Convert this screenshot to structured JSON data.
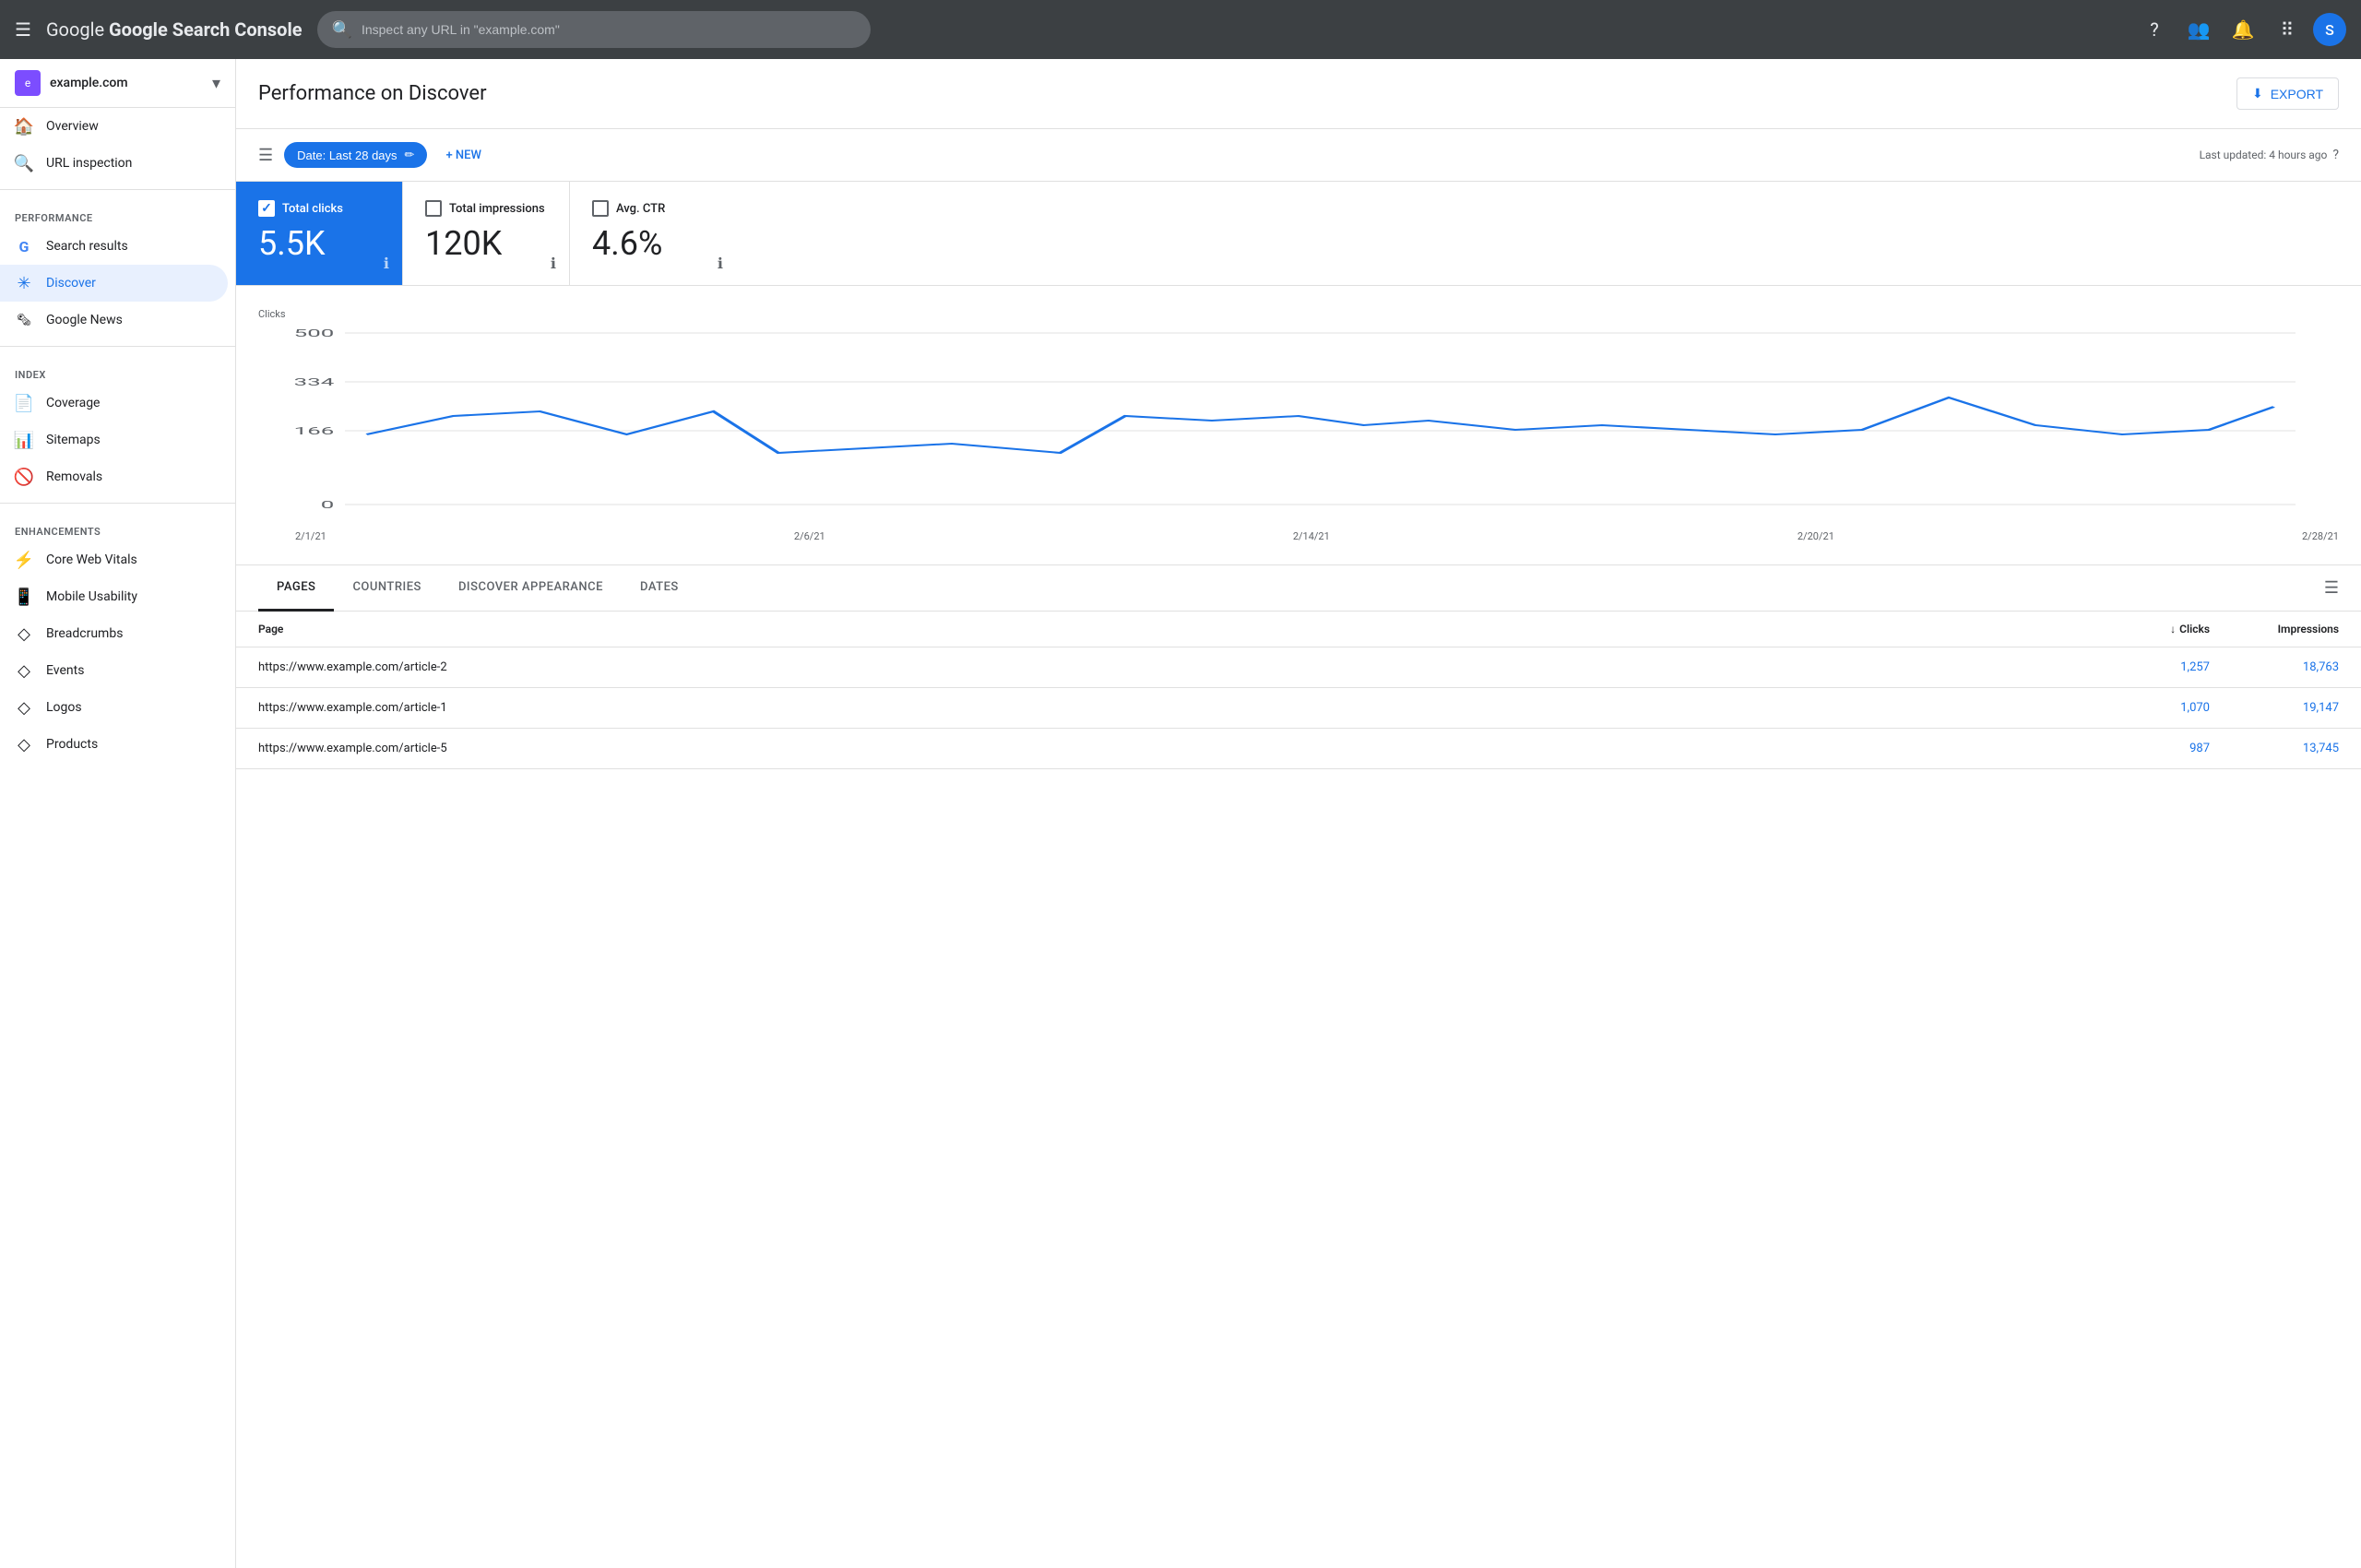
{
  "topnav": {
    "menu_label": "☰",
    "logo": "Google Search Console",
    "search_placeholder": "Inspect any URL in \"example.com\"",
    "avatar_letter": "S"
  },
  "sidebar": {
    "site": {
      "name": "example.com",
      "favicon_letter": "e"
    },
    "nav_items": [
      {
        "id": "overview",
        "label": "Overview",
        "icon": "🏠"
      },
      {
        "id": "url-inspection",
        "label": "URL inspection",
        "icon": "🔍"
      }
    ],
    "performance_label": "Performance",
    "performance_items": [
      {
        "id": "search-results",
        "label": "Search results",
        "icon": "G"
      },
      {
        "id": "discover",
        "label": "Discover",
        "icon": "✳",
        "active": true
      },
      {
        "id": "google-news",
        "label": "Google News",
        "icon": "📰"
      }
    ],
    "index_label": "Index",
    "index_items": [
      {
        "id": "coverage",
        "label": "Coverage",
        "icon": "📄"
      },
      {
        "id": "sitemaps",
        "label": "Sitemaps",
        "icon": "📊"
      },
      {
        "id": "removals",
        "label": "Removals",
        "icon": "🚫"
      }
    ],
    "enhancements_label": "Enhancements",
    "enhancements_items": [
      {
        "id": "core-web-vitals",
        "label": "Core Web Vitals",
        "icon": "⚡"
      },
      {
        "id": "mobile-usability",
        "label": "Mobile Usability",
        "icon": "📱"
      },
      {
        "id": "breadcrumbs",
        "label": "Breadcrumbs",
        "icon": "◇"
      },
      {
        "id": "events",
        "label": "Events",
        "icon": "◇"
      },
      {
        "id": "logos",
        "label": "Logos",
        "icon": "◇"
      },
      {
        "id": "products",
        "label": "Products",
        "icon": "◇"
      }
    ]
  },
  "page": {
    "title": "Performance on Discover",
    "export_label": "EXPORT"
  },
  "filter_bar": {
    "date_label": "Date: Last 28 days",
    "new_label": "+ NEW",
    "last_updated": "Last updated: 4 hours ago"
  },
  "metrics": {
    "total_clicks": {
      "label": "Total clicks",
      "value": "5.5K",
      "active": true
    },
    "total_impressions": {
      "label": "Total impressions",
      "value": "120K",
      "active": false
    },
    "avg_ctr": {
      "label": "Avg. CTR",
      "value": "4.6%",
      "active": false
    }
  },
  "chart": {
    "y_label": "Clicks",
    "y_values": [
      "500",
      "334",
      "166",
      "0"
    ],
    "x_labels": [
      "2/1/21",
      "2/6/21",
      "2/14/21",
      "2/20/21",
      "2/28/21"
    ]
  },
  "tabs": {
    "items": [
      {
        "id": "pages",
        "label": "PAGES",
        "active": true
      },
      {
        "id": "countries",
        "label": "COUNTRIES",
        "active": false
      },
      {
        "id": "discover-appearance",
        "label": "DISCOVER APPEARANCE",
        "active": false
      },
      {
        "id": "dates",
        "label": "DATES",
        "active": false
      }
    ]
  },
  "table": {
    "columns": {
      "page": "Page",
      "clicks": "Clicks",
      "impressions": "Impressions"
    },
    "rows": [
      {
        "page": "https://www.example.com/article-2",
        "clicks": "1,257",
        "impressions": "18,763"
      },
      {
        "page": "https://www.example.com/article-1",
        "clicks": "1,070",
        "impressions": "19,147"
      },
      {
        "page": "https://www.example.com/article-5",
        "clicks": "987",
        "impressions": "13,745"
      }
    ]
  }
}
